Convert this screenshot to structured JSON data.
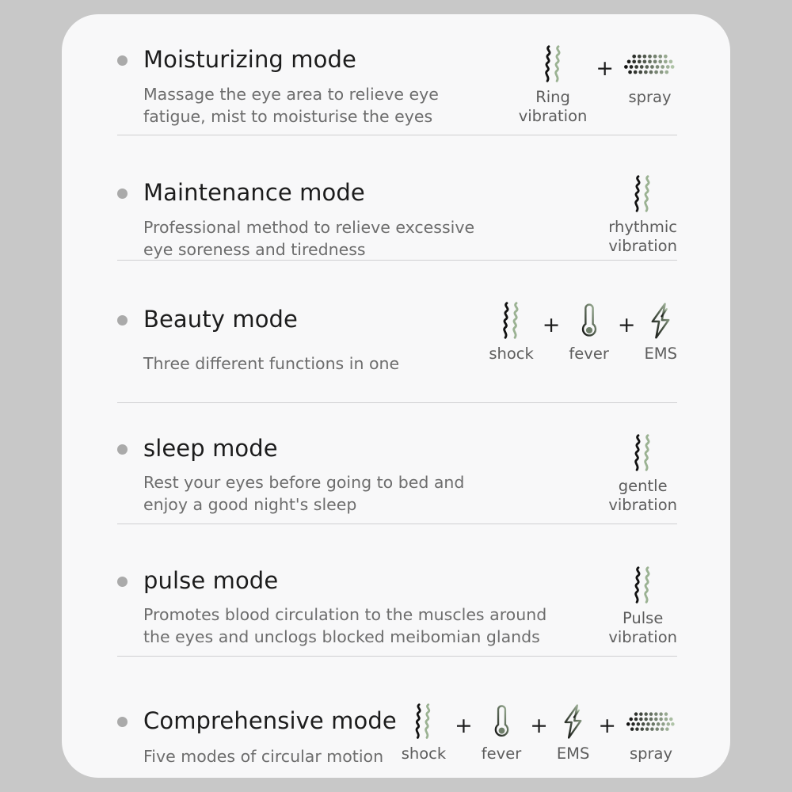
{
  "card": {
    "background_color": "#f8f8f9",
    "page_background_color": "#c8c8c8",
    "accent_green": "#9bb293",
    "bullet_color": "#aaaaaa",
    "divider_color": "#cfcfd1"
  },
  "plus_symbol": "+",
  "modes": [
    {
      "title": "Moisturizing mode",
      "description": "Massage the eye area to relieve eye\nfatigue, mist to moisturise the eyes",
      "icons": [
        {
          "icon": "vibration-icon",
          "label": "Ring\nvibration"
        },
        {
          "icon": "spray-icon",
          "label": "spray"
        }
      ]
    },
    {
      "title": "Maintenance mode",
      "description": "Professional method to relieve excessive\neye soreness and tiredness",
      "icons": [
        {
          "icon": "vibration-icon",
          "label": "rhythmic\nvibration"
        }
      ]
    },
    {
      "title": "Beauty mode",
      "description": "Three different functions in one",
      "icons": [
        {
          "icon": "vibration-icon",
          "label": "shock"
        },
        {
          "icon": "thermometer-icon",
          "label": "fever"
        },
        {
          "icon": "lightning-bolt-icon",
          "label": "EMS"
        }
      ]
    },
    {
      "title": "sleep mode",
      "description": "Rest your eyes before going to bed and\nenjoy a good night's sleep",
      "icons": [
        {
          "icon": "vibration-icon",
          "label": "gentle\nvibration"
        }
      ]
    },
    {
      "title": "pulse mode",
      "description": "Promotes blood circulation to the muscles around\nthe eyes and unclogs blocked meibomian glands",
      "icons": [
        {
          "icon": "vibration-icon",
          "label": "Pulse\nvibration"
        }
      ]
    },
    {
      "title": "Comprehensive mode",
      "description": "Five modes of circular motion",
      "icons": [
        {
          "icon": "vibration-icon",
          "label": "shock"
        },
        {
          "icon": "thermometer-icon",
          "label": "fever"
        },
        {
          "icon": "lightning-bolt-icon",
          "label": "EMS"
        },
        {
          "icon": "spray-icon",
          "label": "spray"
        }
      ]
    }
  ]
}
